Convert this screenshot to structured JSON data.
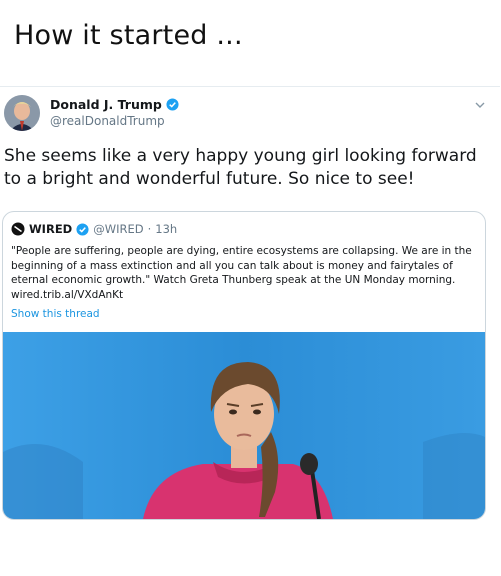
{
  "header": {
    "caption": "How it started ..."
  },
  "tweet": {
    "author_name": "Donald J. Trump",
    "author_handle": "@realDonaldTrump",
    "text": "She seems like a very happy young girl looking forward to a bright and wonderful future. So nice to see!",
    "menu_icon": "chevron-down-icon"
  },
  "quoted": {
    "author_name": "WIRED",
    "author_handle": "@WIRED",
    "separator": "·",
    "time": "13h",
    "text": "\"People are suffering, people are dying, entire ecosystems are collapsing. We are in the beginning of a mass extinction and all you can talk about is money and fairytales of eternal economic growth.\" Watch Greta Thunberg speak at the UN Monday morning. wired.trib.al/VXdAnKt",
    "show_thread": "Show this thread"
  },
  "colors": {
    "link": "#1b95e0",
    "verified": "#1da1f2",
    "photo_bg": "#2a8fd6",
    "sweater": "#d8336f"
  }
}
